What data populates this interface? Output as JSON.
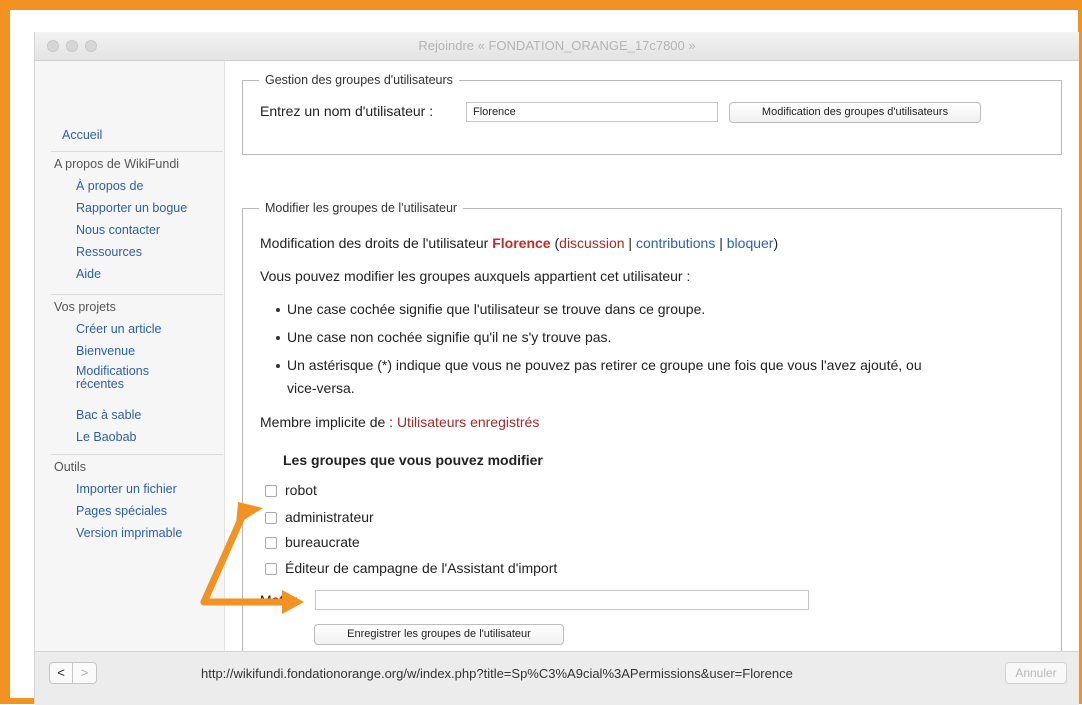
{
  "window": {
    "title": "Rejoindre « FONDATION_ORANGE_17c7800 »"
  },
  "sidebar": {
    "home": "Accueil",
    "about_head": "A propos de WikiFundi",
    "about_items": [
      "À propos de",
      "Rapporter un bogue",
      "Nous contacter",
      "Ressources",
      "Aide"
    ],
    "projects_head": "Vos projets",
    "projects_items": [
      "Créer un article",
      "Bienvenue",
      "Modifications récentes",
      "Bac à sable",
      "Le Baobab"
    ],
    "tools_head": "Outils",
    "tools_items": [
      "Importer un fichier",
      "Pages spéciales",
      "Version imprimable"
    ]
  },
  "manage_box": {
    "legend": "Gestion des groupes d'utilisateurs",
    "label": "Entrez un nom d'utilisateur :",
    "username_value": "Florence",
    "button": "Modification des groupes d'utilisateurs"
  },
  "edit_box": {
    "legend": "Modifier les groupes de l'utilisateur",
    "rights_prefix": "Modification des droits de l'utilisateur",
    "user": "Florence",
    "paren_open": "(",
    "link_discussion": "discussion",
    "sep1": "|",
    "link_contributions": "contributions",
    "sep2": "|",
    "link_block": "bloquer",
    "paren_close": ")",
    "intro": "Vous pouvez modifier les groupes auxquels appartient cet utilisateur :",
    "bullets": [
      "Une case cochée signifie que l'utilisateur se trouve dans ce groupe.",
      "Une case non cochée signifie qu'il ne s'y trouve pas.",
      "Un astérisque (*) indique que vous ne pouvez pas retirer ce groupe une fois que vous l'avez ajouté, ou",
      "vice-versa."
    ],
    "implicit_label": "Membre implicite de :",
    "implicit_link": "Utilisateurs enregistrés",
    "groups_heading": "Les groupes que vous pouvez modifier",
    "groups": [
      "robot",
      "administrateur",
      "bureaucrate",
      "Éditeur de campagne de l'Assistant d'import"
    ],
    "reason_label": "Motif :",
    "reason_value": "",
    "save_button": "Enregistrer les groupes de l'utilisateur"
  },
  "statusbar": {
    "back": "<",
    "forward": ">",
    "url": "http://wikifundi.fondationorange.org/w/index.php?title=Sp%C3%A9cial%3APermissions&user=Florence",
    "cancel": "Annuler"
  },
  "colors": {
    "frame": "#f29222",
    "arrow": "#f29222",
    "link": "#2e5fa7",
    "red_link": "#a72a2a"
  }
}
